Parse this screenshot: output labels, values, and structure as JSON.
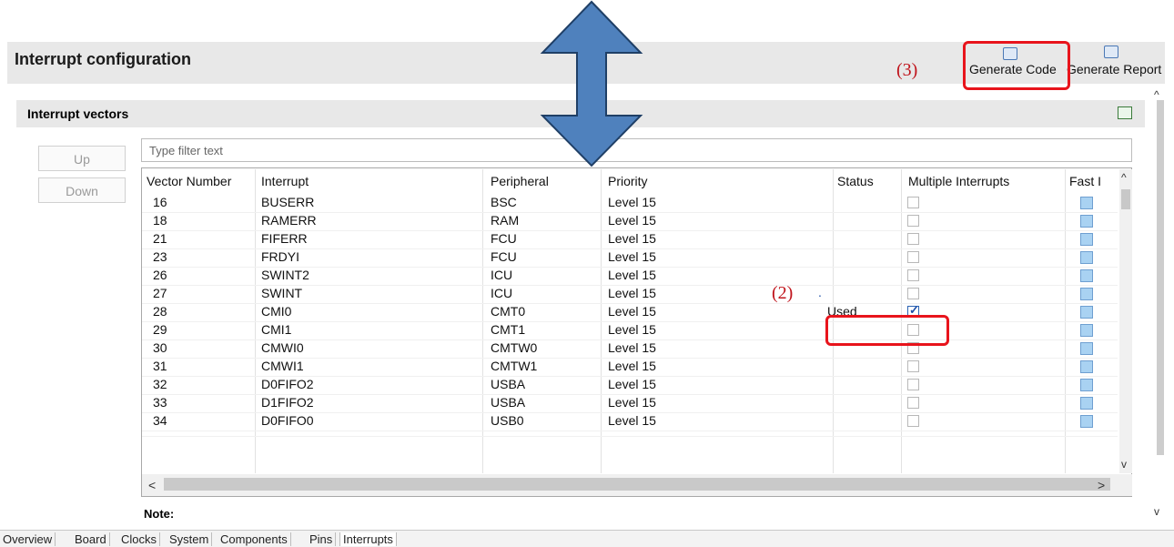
{
  "header": {
    "title": "Interrupt configuration",
    "generate_code_label": "Generate Code",
    "generate_report_label": "Generate Report",
    "generate_code_icon": "generate-code-icon",
    "generate_report_icon": "generate-report-icon"
  },
  "section": {
    "title": "Interrupt vectors",
    "icon": "expand-icon"
  },
  "buttons": {
    "up": "Up",
    "down": "Down"
  },
  "filter": {
    "placeholder": "Type filter text",
    "value": ""
  },
  "table": {
    "columns": [
      "Vector Number",
      "Interrupt",
      "Peripheral",
      "Priority",
      "Status",
      "Multiple Interrupts",
      "Fast I"
    ],
    "rows": [
      {
        "vector": "16",
        "interrupt": "BUSERR",
        "peripheral": "BSC",
        "priority": "Level 15",
        "status": "",
        "multiple": false
      },
      {
        "vector": "18",
        "interrupt": "RAMERR",
        "peripheral": "RAM",
        "priority": "Level 15",
        "status": "",
        "multiple": false
      },
      {
        "vector": "21",
        "interrupt": "FIFERR",
        "peripheral": "FCU",
        "priority": "Level 15",
        "status": "",
        "multiple": false
      },
      {
        "vector": "23",
        "interrupt": "FRDYI",
        "peripheral": "FCU",
        "priority": "Level 15",
        "status": "",
        "multiple": false
      },
      {
        "vector": "26",
        "interrupt": "SWINT2",
        "peripheral": "ICU",
        "priority": "Level 15",
        "status": "",
        "multiple": false
      },
      {
        "vector": "27",
        "interrupt": "SWINT",
        "peripheral": "ICU",
        "priority": "Level 15",
        "status": "",
        "multiple": false
      },
      {
        "vector": "28",
        "interrupt": "CMI0",
        "peripheral": "CMT0",
        "priority": "Level 15",
        "status": "Used",
        "multiple": true
      },
      {
        "vector": "29",
        "interrupt": "CMI1",
        "peripheral": "CMT1",
        "priority": "Level 15",
        "status": "",
        "multiple": false
      },
      {
        "vector": "30",
        "interrupt": "CMWI0",
        "peripheral": "CMTW0",
        "priority": "Level 15",
        "status": "",
        "multiple": false
      },
      {
        "vector": "31",
        "interrupt": "CMWI1",
        "peripheral": "CMTW1",
        "priority": "Level 15",
        "status": "",
        "multiple": false
      },
      {
        "vector": "32",
        "interrupt": "D0FIFO2",
        "peripheral": "USBA",
        "priority": "Level 15",
        "status": "",
        "multiple": false
      },
      {
        "vector": "33",
        "interrupt": "D1FIFO2",
        "peripheral": "USBA",
        "priority": "Level 15",
        "status": "",
        "multiple": false
      },
      {
        "vector": "34",
        "interrupt": "D0FIFO0",
        "peripheral": "USB0",
        "priority": "Level 15",
        "status": "",
        "multiple": false
      }
    ]
  },
  "note_label": "Note:",
  "tabs": [
    "Overview",
    "Board",
    "Clocks",
    "System",
    "Components",
    "Pins",
    "Interrupts"
  ],
  "active_tab": "Interrupts",
  "annotations": {
    "step2": "(2)",
    "step2_dot": ".",
    "step3": "(3)"
  },
  "scroll": {
    "left": "<",
    "right": ">",
    "up": "^",
    "down": "v"
  },
  "colors": {
    "highlight": "#e8141c",
    "arrow_fill": "#4f81bd",
    "arrow_stroke": "#1f3f66"
  }
}
